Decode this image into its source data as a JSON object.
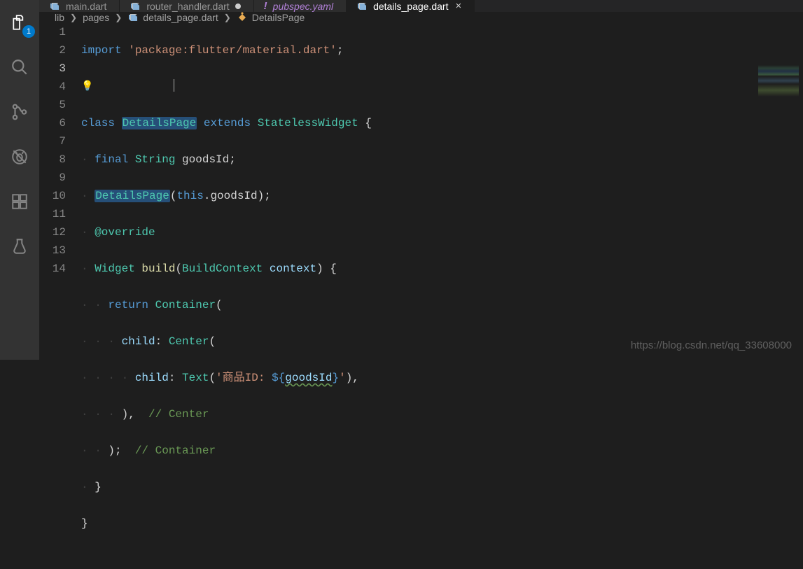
{
  "activity": {
    "explorer_badge": "1"
  },
  "tabs": [
    {
      "label": "main.dart",
      "icon": "dart",
      "active": false
    },
    {
      "label": "router_handler.dart",
      "icon": "dart",
      "active": false,
      "dirty": true
    },
    {
      "label": "pubspec.yaml",
      "icon": "yaml",
      "active": false,
      "italic": true
    },
    {
      "label": "details_page.dart",
      "icon": "dart",
      "active": true,
      "close": true
    }
  ],
  "breadcrumb": {
    "seg1": "lib",
    "seg2": "pages",
    "seg3": "details_page.dart",
    "seg4": "DetailsPage"
  },
  "code": {
    "current_line": 3,
    "l1": {
      "kw": "import",
      "str": "'package:flutter/material.dart'",
      "end": ";"
    },
    "l3": {
      "kw1": "class",
      "name": "DetailsPage",
      "kw2": "extends",
      "base": "StatelessWidget",
      "brace": " {"
    },
    "l4": {
      "kw": "final",
      "type": "String",
      "id": " goodsId;"
    },
    "l5": {
      "type": "DetailsPage",
      "p1": "(",
      "kw": "this",
      "p2": ".goodsId);"
    },
    "l6": {
      "anno": "@override"
    },
    "l7": {
      "type": "Widget",
      "fn": "build",
      "p1": "(",
      "argtype": "BuildContext",
      "arg": " context",
      "p2": ") {"
    },
    "l8": {
      "kw": "return",
      "type": "Container",
      "p": "("
    },
    "l9": {
      "var": "child",
      "p1": ": ",
      "type": "Center",
      "p2": "("
    },
    "l10": {
      "var": "child",
      "p1": ": ",
      "type": "Text",
      "p2": "(",
      "str1": "'商品ID: ",
      "interp": "${",
      "interpvar": "goodsId",
      "interp2": "}",
      "str2": "'",
      "p3": "),"
    },
    "l11": {
      "p": "), ",
      "com": " // Center"
    },
    "l12": {
      "p": "); ",
      "com": " // Container"
    },
    "l13": {
      "p": "}"
    },
    "l14": {
      "p": "}"
    }
  },
  "watermark": "https://blog.csdn.net/qq_33608000"
}
